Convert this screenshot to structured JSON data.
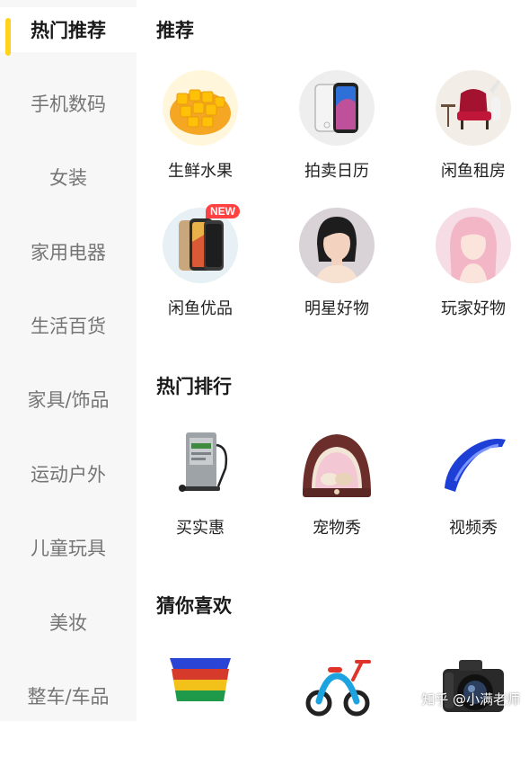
{
  "sidebar": {
    "items": [
      {
        "label": "热门推荐",
        "active": true
      },
      {
        "label": "手机数码"
      },
      {
        "label": "女装"
      },
      {
        "label": "家用电器"
      },
      {
        "label": "生活百货"
      },
      {
        "label": "家具/饰品"
      },
      {
        "label": "运动户外"
      },
      {
        "label": "儿童玩具"
      },
      {
        "label": "美妆"
      },
      {
        "label": "整车/车品"
      }
    ],
    "accent_color": "#ffd21e"
  },
  "sections": {
    "recommend": {
      "title": "推荐",
      "items": [
        {
          "label": "生鲜水果",
          "icon": "mango-image"
        },
        {
          "label": "拍卖日历",
          "icon": "smartphones-image"
        },
        {
          "label": "闲鱼租房",
          "icon": "armchair-image"
        },
        {
          "label": "闲鱼优品",
          "icon": "smartphone-image",
          "badge": "NEW"
        },
        {
          "label": "明星好物",
          "icon": "celebrity-portrait-image"
        },
        {
          "label": "玩家好物",
          "icon": "pink-hair-portrait-image"
        }
      ]
    },
    "hot_rank": {
      "title": "热门排行",
      "items": [
        {
          "label": "买实惠",
          "icon": "hard-drive-image"
        },
        {
          "label": "宠物秀",
          "icon": "pet-bed-image"
        },
        {
          "label": "视频秀",
          "icon": "motorcycle-fender-image"
        }
      ]
    },
    "guess": {
      "title": "猜你喜欢",
      "items": [
        {
          "icon": "storage-bins-image"
        },
        {
          "icon": "balance-bike-image"
        },
        {
          "icon": "camera-image"
        }
      ]
    }
  },
  "watermark": "知乎 @小满老师",
  "badge_color": "#ff4141"
}
